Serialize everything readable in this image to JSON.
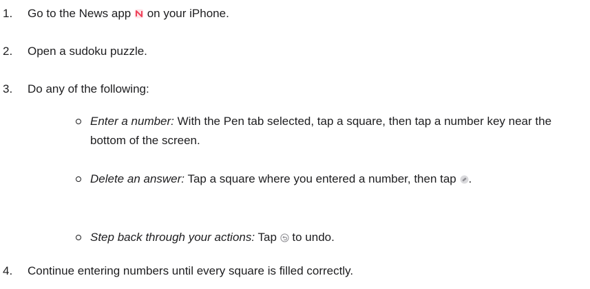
{
  "steps": [
    {
      "number": "1.",
      "before": "Go to the News app",
      "icon": "news-app-icon",
      "after": " on your iPhone."
    },
    {
      "number": "2.",
      "text": "Open a sudoku puzzle."
    },
    {
      "number": "3.",
      "text": "Do any of the following:"
    },
    {
      "number": "4.",
      "text": "Continue entering numbers until every square is filled correctly."
    }
  ],
  "substeps": [
    {
      "label": "Enter a number:",
      "text": " With the Pen tab selected, tap a square, then tap a number key near the bottom of the screen."
    },
    {
      "label": "Delete an answer:",
      "before": " Tap a square where you entered a number, then tap",
      "icon": "eraser-icon",
      "after": "."
    },
    {
      "label": "Step back through your actions:",
      "before": " Tap",
      "icon": "undo-icon",
      "after": " to undo."
    }
  ],
  "colors": {
    "text": "#1d1d1f",
    "news_icon": "#f0435b",
    "icon_gray": "#9a9a9f"
  }
}
